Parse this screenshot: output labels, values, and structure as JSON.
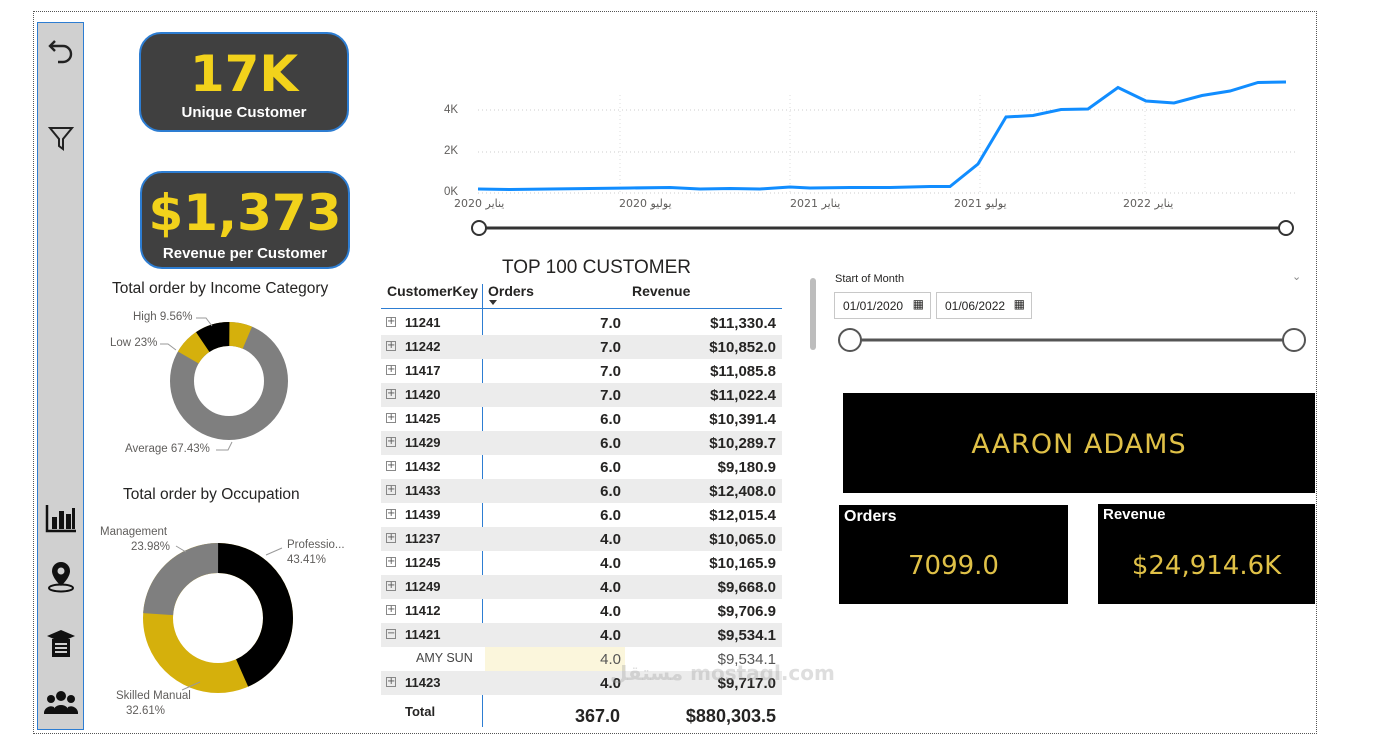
{
  "sidebar": {
    "icons": [
      "back-arrow-icon",
      "filter-icon",
      "bar-chart-icon",
      "location-pin-icon",
      "graduation-cap-icon",
      "people-group-icon"
    ]
  },
  "kpi_customers": {
    "value": "17K",
    "label": "Unique Customer"
  },
  "kpi_revenue": {
    "value": "$1,373",
    "label": "Revenue per Customer"
  },
  "income_chart": {
    "title": "Total order by Income Category",
    "slices": [
      {
        "label": "High",
        "pct": "9.56%"
      },
      {
        "label": "Low",
        "pct": "23%"
      },
      {
        "label": "Average",
        "pct": "67.43%"
      }
    ]
  },
  "occupation_chart": {
    "title": "Total order by Occupation",
    "slices": [
      {
        "label": "Management",
        "pct": "23.98%"
      },
      {
        "label": "Professio...",
        "pct": "43.41%"
      },
      {
        "label": "Skilled Manual",
        "pct": "32.61%"
      }
    ]
  },
  "line_chart": {
    "y_ticks": [
      "4K",
      "2K",
      "0K"
    ],
    "x_ticks": [
      "يناير 2020",
      "يوليو 2020",
      "يناير 2021",
      "يوليو 2021",
      "يناير 2022"
    ]
  },
  "table": {
    "title": "TOP 100 CUSTOMER",
    "headers": {
      "key": "CustomerKey",
      "orders": "Orders",
      "revenue": "Revenue"
    },
    "rows": [
      {
        "key": "11241",
        "orders": "7.0",
        "revenue": "$11,330.4",
        "exp": "+"
      },
      {
        "key": "11242",
        "orders": "7.0",
        "revenue": "$10,852.0",
        "exp": "+"
      },
      {
        "key": "11417",
        "orders": "7.0",
        "revenue": "$11,085.8",
        "exp": "+"
      },
      {
        "key": "11420",
        "orders": "7.0",
        "revenue": "$11,022.4",
        "exp": "+"
      },
      {
        "key": "11425",
        "orders": "6.0",
        "revenue": "$10,391.4",
        "exp": "+"
      },
      {
        "key": "11429",
        "orders": "6.0",
        "revenue": "$10,289.7",
        "exp": "+"
      },
      {
        "key": "11432",
        "orders": "6.0",
        "revenue": "$9,180.9",
        "exp": "+"
      },
      {
        "key": "11433",
        "orders": "6.0",
        "revenue": "$12,408.0",
        "exp": "+"
      },
      {
        "key": "11439",
        "orders": "6.0",
        "revenue": "$12,015.4",
        "exp": "+"
      },
      {
        "key": "11237",
        "orders": "4.0",
        "revenue": "$10,065.0",
        "exp": "+"
      },
      {
        "key": "11245",
        "orders": "4.0",
        "revenue": "$10,165.9",
        "exp": "+"
      },
      {
        "key": "11249",
        "orders": "4.0",
        "revenue": "$9,668.0",
        "exp": "+"
      },
      {
        "key": "11412",
        "orders": "4.0",
        "revenue": "$9,706.9",
        "exp": "+"
      },
      {
        "key": "11421",
        "orders": "4.0",
        "revenue": "$9,534.1",
        "exp": "−"
      },
      {
        "key": "AMY SUN",
        "orders": "4.0",
        "revenue": "$9,534.1",
        "child": true
      },
      {
        "key": "11423",
        "orders": "4.0",
        "revenue": "$9,717.0",
        "exp": "+"
      }
    ],
    "total": {
      "label": "Total",
      "orders": "367.0",
      "revenue": "$880,303.5"
    }
  },
  "date_slicer": {
    "label": "Start of Month",
    "start": "01/01/2020",
    "end": "01/06/2022"
  },
  "customer_name": "AARON ADAMS",
  "card_orders": {
    "label": "Orders",
    "value": "7099.0"
  },
  "card_revenue": {
    "label": "Revenue",
    "value": "$24,914.6K"
  },
  "watermark": "مستقل mostaql.com"
}
